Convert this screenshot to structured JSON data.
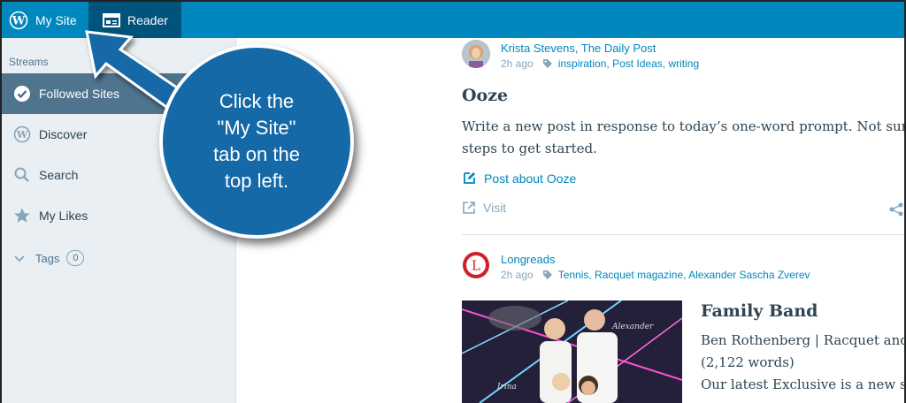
{
  "topbar": {
    "my_site_label": "My Site",
    "reader_label": "Reader"
  },
  "sidebar": {
    "section_label": "Streams",
    "items": [
      {
        "label": "Followed Sites",
        "icon": "checkmark-circle-icon",
        "active": true
      },
      {
        "label": "Discover",
        "icon": "wordpress-icon"
      },
      {
        "label": "Search",
        "icon": "search-icon"
      },
      {
        "label": "My Likes",
        "icon": "star-icon"
      }
    ],
    "tags_label": "Tags",
    "tags_count": "0"
  },
  "posts": [
    {
      "author": "Krista Stevens, The Daily Post",
      "time": "2h ago",
      "tags": "inspiration, Post Ideas, writing",
      "title": "Ooze",
      "excerpt_line1": "Write a new post in response to today’s one-word prompt. Not sure",
      "excerpt_line2": "steps to get started.",
      "action_post": "Post about Ooze",
      "action_visit": "Visit"
    },
    {
      "author": "Longreads",
      "time": "2h ago",
      "tags": "Tennis, Racquet magazine, Alexander Sascha Zverev",
      "title": "Family Band",
      "excerpt_line1": "Ben Rothenberg | Racquet and",
      "excerpt_line2": "(2,122 words)",
      "excerpt_line3": "Our latest Exclusive is a new s",
      "image_label_1": "Alexander",
      "image_label_2": "Irina"
    }
  ],
  "callout": {
    "line1": "Click the",
    "line2": "\"My Site\"",
    "line3": "tab on the",
    "line4": "top left."
  },
  "colors": {
    "accent": "#0087be",
    "callout": "#1569a6",
    "sidebar_active": "#4f748e"
  }
}
